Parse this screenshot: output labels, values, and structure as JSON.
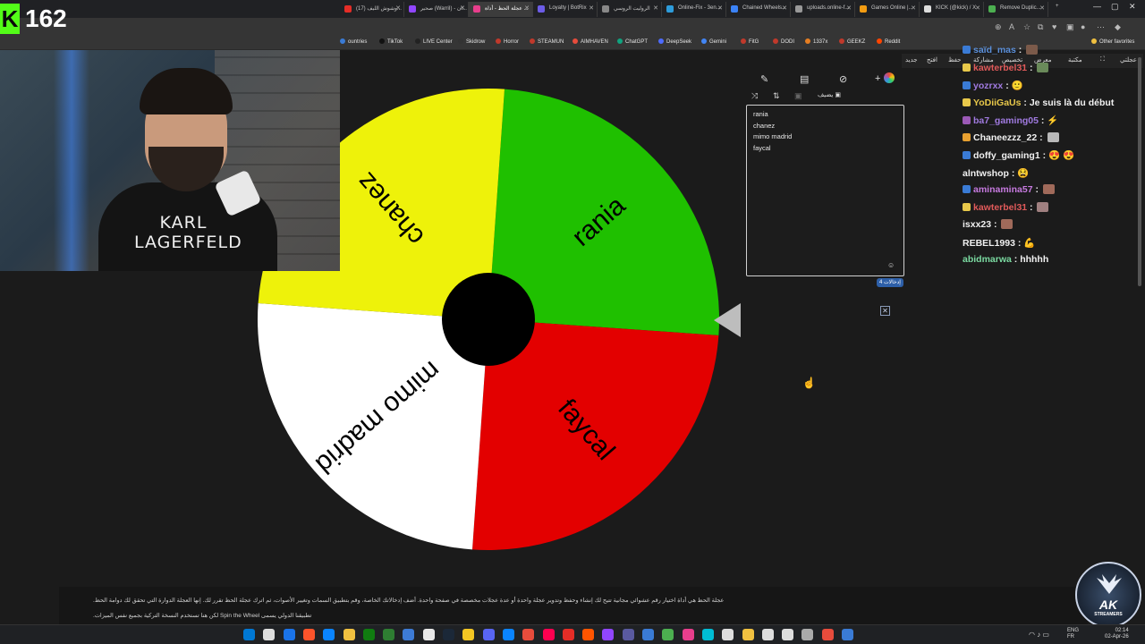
{
  "browser": {
    "tabs": [
      {
        "label": "(17) وشوش الليف...",
        "color": "#e52d27",
        "active": false
      },
      {
        "label": "صحير (WarriI) - ان...",
        "color": "#9146ff",
        "active": false
      },
      {
        "label": "عجلة الحظ - أداة ...",
        "color": "#e83e8c",
        "active": true
      },
      {
        "label": "Loyalty | BotRix",
        "color": "#6c5ce7",
        "active": false
      },
      {
        "label": "الروليت الروسي",
        "color": "#888888",
        "active": false
      },
      {
        "label": "Online-Fix - 3en...",
        "color": "#2d9cdb",
        "active": false
      },
      {
        "label": "Chained Wheels...",
        "color": "#3b82f6",
        "active": false
      },
      {
        "label": "uploads.online-f...",
        "color": "#999999",
        "active": false
      },
      {
        "label": "Games Online |...",
        "color": "#f39c12",
        "active": false
      },
      {
        "label": "KICK (@kick) / X",
        "color": "#dddddd",
        "active": false
      },
      {
        "label": "Remove Duplic...",
        "color": "#4caf50",
        "active": false
      }
    ],
    "bookmarks": [
      {
        "label": "ountries",
        "color": "#3a7bd5"
      },
      {
        "label": "TikTok",
        "color": "#111111"
      },
      {
        "label": "LIVE Center",
        "color": "#222222"
      },
      {
        "label": "Skidrow",
        "color": "#333333"
      },
      {
        "label": "Horror",
        "color": "#c0392b"
      },
      {
        "label": "STEAMUN",
        "color": "#c0392b"
      },
      {
        "label": "AIMHAVEN",
        "color": "#e74c3c"
      },
      {
        "label": "ChatGPT",
        "color": "#10a37f"
      },
      {
        "label": "DeepSeek",
        "color": "#4d6bfe"
      },
      {
        "label": "Gemini",
        "color": "#4285f4"
      },
      {
        "label": "FitG",
        "color": "#c0392b"
      },
      {
        "label": "DODI",
        "color": "#c0392b"
      },
      {
        "label": "1337x",
        "color": "#e67e22"
      },
      {
        "label": "GEEKZ",
        "color": "#c0392b"
      },
      {
        "label": "Reddit",
        "color": "#ff4500"
      }
    ],
    "other_favorites": "Other favorites"
  },
  "stream": {
    "viewer_count": "162",
    "kick_letter": "K",
    "shirt_text_line1": "KARL",
    "shirt_text_line2": "LAGERFELD"
  },
  "wheel": {
    "center_color": "#000000",
    "segments": [
      {
        "label": "rania",
        "color": "#1fc000"
      },
      {
        "label": "chanez",
        "color": "#eef20a"
      },
      {
        "label": "mimo madrid",
        "color": "#ffffff"
      },
      {
        "label": "faycal",
        "color": "#e30000"
      }
    ]
  },
  "panel": {
    "add_label": "يضيف",
    "entries": [
      "rania",
      "chanez",
      "mimo madrid",
      "faycal"
    ],
    "entry_count": "4 إدخالات",
    "toolbar": {
      "new": "جديد",
      "open": "افتح",
      "save": "حفظ",
      "share": "مشاركة",
      "customize": "تخصيص",
      "gallery": "معرض",
      "more": "مكتبة",
      "language": "عجلتي"
    }
  },
  "chat": {
    "messages": [
      {
        "user": "saïd_mas",
        "text": "",
        "color": "#5b8fd9",
        "emote": "#7b5a4a"
      },
      {
        "user": "kawterbel31",
        "text": "",
        "color": "#e05a5a",
        "emote": "#6a8a5a"
      },
      {
        "user": "yozrxx",
        "text": "🙂",
        "color": "#a07ae0",
        "emote": ""
      },
      {
        "user": "YoDiiGaUs",
        "text": "Je suis là du début",
        "color": "#e8c84a",
        "emote": ""
      },
      {
        "user": "ba7_gaming05",
        "text": "⚡",
        "color": "#a07ae0",
        "emote": ""
      },
      {
        "user": "Chaneezzz_22",
        "text": "",
        "color": "#f0f0f0",
        "emote": "#b8b8b8"
      },
      {
        "user": "doffy_gaming1",
        "text": "😍 😍",
        "color": "#f0f0f0",
        "emote": ""
      },
      {
        "user": "alntwshop",
        "text": "😫",
        "color": "#f0f0f0",
        "emote": ""
      },
      {
        "user": "aminamina57",
        "text": "",
        "color": "#c77ae0",
        "emote": "#a06a5a"
      },
      {
        "user": "kawterbel31",
        "text": "",
        "color": "#e05a5a",
        "emote": "#a08080"
      },
      {
        "user": "isxx23",
        "text": "",
        "color": "#f0f0f0",
        "emote": "#a06a5a"
      },
      {
        "user": "REBEL1993",
        "text": "💪",
        "color": "#f0f0f0",
        "emote": ""
      },
      {
        "user": "abidmarwa",
        "text": "hhhhh",
        "color": "#7ad9a0",
        "emote": ""
      }
    ]
  },
  "footer": {
    "line1": ".عجلة الحظ هي أداة اختيار رقم عشوائي مجانية تتيح لك إنشاء وحفظ وتدوير عجلة واحدة أو عدة عجلات مخصصة في صفحة واحدة. أضف إدخالاتك الخاصة، وقم بتطبيق السمات وتغيير الأصوات، ثم اترك عجلة الحظ تقرر لك. إنها العجلة الدوارة التي تحقق لك دوامة الحظ",
    "line2": ".لكن هنا تستخدم النسخة التركية بجميع نفس الميزات Spin the Wheel تطبيقنا الدولي يسمى"
  },
  "logo": {
    "main": "AK",
    "sub": "STREAMERS"
  },
  "taskbar": {
    "lang_top": "ENG",
    "lang_bottom": "FR",
    "time": "02:14",
    "date": "02-Apr-26"
  }
}
